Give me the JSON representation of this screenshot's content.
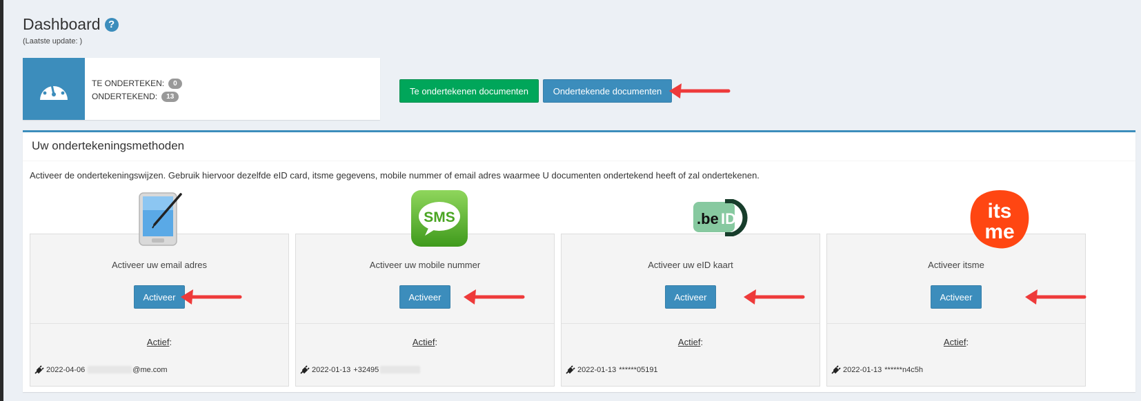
{
  "page": {
    "title": "Dashboard",
    "subtitle": "(Laatste update: )"
  },
  "summary": {
    "to_sign_label": "TE ONDERTEKEN:",
    "to_sign_count": "0",
    "signed_label": "ONDERTEKEND:",
    "signed_count": "13"
  },
  "toolbar": {
    "to_sign_docs": "Te ondertekenen documenten",
    "signed_docs": "Ondertekende documenten"
  },
  "methods_panel": {
    "title": "Uw ondertekeningsmethoden",
    "description": "Activeer de ondertekeningswijzen. Gebruik hiervoor dezelfde eID card, itsme gegevens, mobile nummer of email adres waarmee U documenten ondertekend heeft of zal ondertekenen.",
    "cards": [
      {
        "label": "Activeer uw email adres",
        "button": "Activeer",
        "status_label": "Actief",
        "status_colon": ":",
        "entry_date": "2022-04-06",
        "entry_value": "@me.com",
        "icon": "tablet-pen-icon"
      },
      {
        "label": "Activeer uw mobile nummer",
        "button": "Activeer",
        "status_label": "Actief",
        "status_colon": ":",
        "entry_date": "2022-01-13",
        "entry_value": "+32495",
        "icon": "sms-icon"
      },
      {
        "label": "Activeer uw eID kaart",
        "button": "Activeer",
        "status_label": "Actief",
        "status_colon": ":",
        "entry_date": "2022-01-13",
        "entry_value": "******05191",
        "icon": "beid-logo"
      },
      {
        "label": "Activeer itsme",
        "button": "Activeer",
        "status_label": "Actief",
        "status_colon": ":",
        "entry_date": "2022-01-13",
        "entry_value": "******n4c5h",
        "icon": "itsme-logo"
      }
    ]
  },
  "logos": {
    "sms_text": "SMS",
    "beid_text": ".be",
    "beid_id": "ID",
    "itsme_top": "its",
    "itsme_bottom": "me"
  },
  "colors": {
    "primary": "#3c8dbc",
    "success": "#00a65a",
    "annotation_arrow": "#ee3a3a",
    "itsme": "#ff4612",
    "sms_green": "#5cb82b"
  }
}
